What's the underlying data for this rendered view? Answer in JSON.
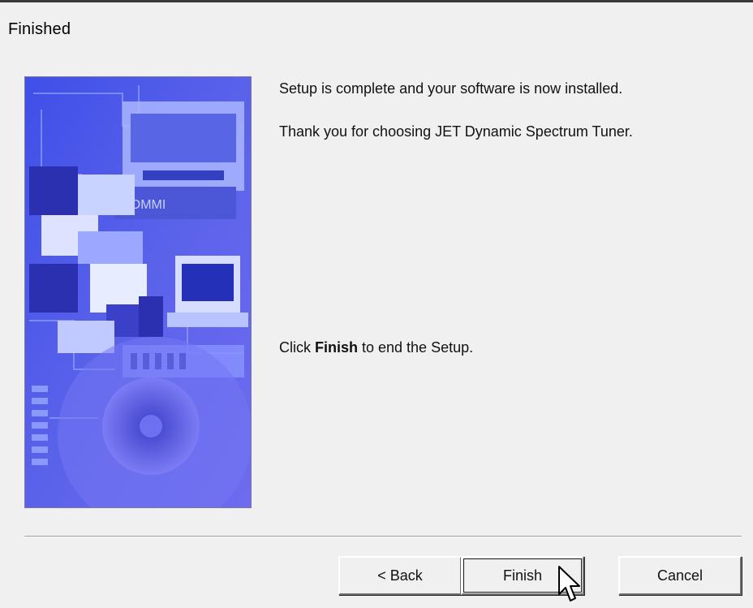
{
  "window": {
    "title": "Finished"
  },
  "messages": {
    "complete": "Setup is complete and your software is now installed.",
    "thanks": "Thank you for choosing JET Dynamic Spectrum Tuner.",
    "click_prefix": "Click ",
    "click_bold": "Finish",
    "click_suffix": " to end the Setup."
  },
  "buttons": {
    "back": "< Back",
    "finish": "Finish",
    "cancel": "Cancel"
  },
  "colors": {
    "artwork_blue": "#4a50e0",
    "dialog_bg": "#f0f0f0"
  },
  "icons": {
    "cursor": "arrow-cursor-icon"
  }
}
